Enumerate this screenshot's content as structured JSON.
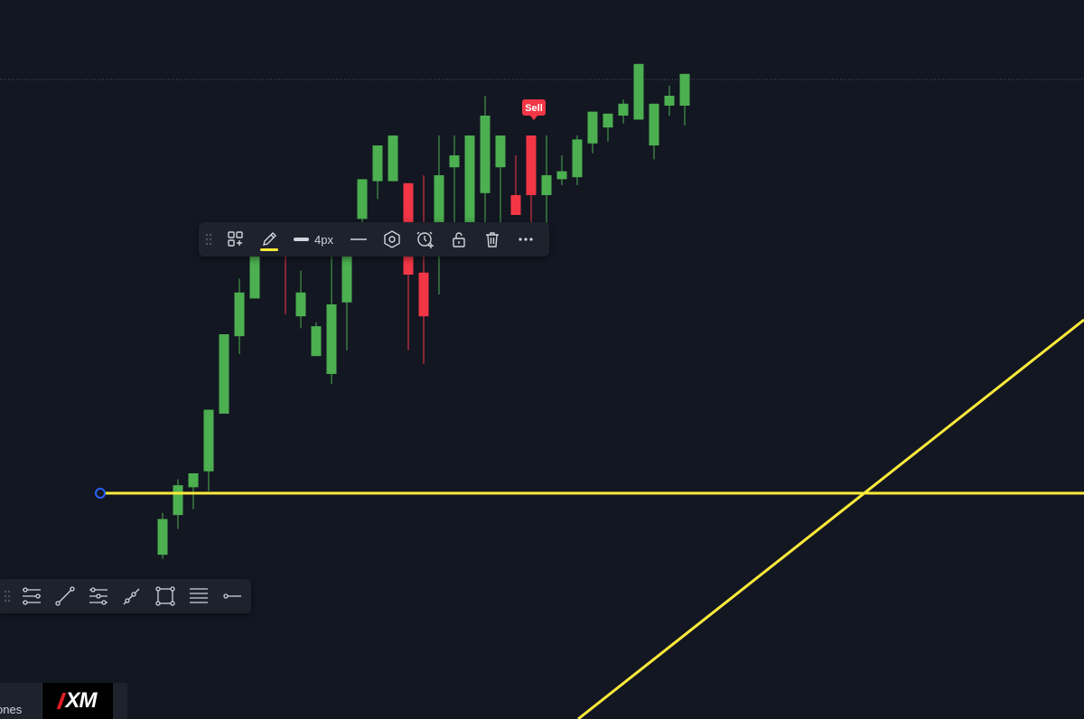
{
  "colors": {
    "background": "#131722",
    "bull": "#4caf50",
    "bear": "#f23645",
    "drawing": "#ffeb3b",
    "anchor": "#2962ff",
    "toolbar_bg": "#1e222d",
    "icon": "#d1d4dc"
  },
  "chart_data": {
    "type": "candlestick",
    "horizontal_line_price": 0,
    "candles": [
      {
        "o": -31,
        "h": -10,
        "l": -33,
        "c": -13
      },
      {
        "o": -11,
        "h": 7,
        "l": -18,
        "c": 4
      },
      {
        "o": 3,
        "h": 8,
        "l": -8,
        "c": 10
      },
      {
        "o": 11,
        "h": 41,
        "l": 1,
        "c": 42
      },
      {
        "o": 40,
        "h": 77,
        "l": 40,
        "c": 80
      },
      {
        "o": 79,
        "h": 108,
        "l": 70,
        "c": 101
      },
      {
        "o": 98,
        "h": 124,
        "l": 99,
        "c": 130
      },
      {
        "o": 127,
        "h": 131,
        "l": 120,
        "c": 125
      },
      {
        "o": 124,
        "h": 126,
        "l": 90,
        "c": 120
      },
      {
        "o": 89,
        "h": 112,
        "l": 83,
        "c": 101
      },
      {
        "o": 69,
        "h": 86,
        "l": 69,
        "c": 84
      },
      {
        "o": 60,
        "h": 126,
        "l": 55,
        "c": 95
      },
      {
        "o": 96,
        "h": 117,
        "l": 72,
        "c": 127
      },
      {
        "o": 138,
        "h": 140,
        "l": 120,
        "c": 158
      },
      {
        "o": 157,
        "h": 160,
        "l": 148,
        "c": 175
      },
      {
        "o": 157,
        "h": 170,
        "l": 160,
        "c": 180
      },
      {
        "o": 156,
        "h": 140,
        "l": 72,
        "c": 110
      },
      {
        "o": 111,
        "h": 160,
        "l": 65,
        "c": 89
      },
      {
        "o": 127,
        "h": 180,
        "l": 100,
        "c": 160
      },
      {
        "o": 164,
        "h": 180,
        "l": 135,
        "c": 170
      },
      {
        "o": 129,
        "h": 180,
        "l": 129,
        "c": 180
      },
      {
        "o": 151,
        "h": 200,
        "l": 135,
        "c": 190
      },
      {
        "o": 164,
        "h": 180,
        "l": 130,
        "c": 180
      },
      {
        "o": 150,
        "h": 170,
        "l": 160,
        "c": 140
      },
      {
        "o": 180,
        "h": 180,
        "l": 120,
        "c": 150
      },
      {
        "o": 150,
        "h": 180,
        "l": 130,
        "c": 160
      },
      {
        "o": 158,
        "h": 170,
        "l": 155,
        "c": 162
      },
      {
        "o": 159,
        "h": 180,
        "l": 155,
        "c": 178
      },
      {
        "o": 176,
        "h": 180,
        "l": 171,
        "c": 192
      },
      {
        "o": 184,
        "h": 187,
        "l": 177,
        "c": 191
      },
      {
        "o": 190,
        "h": 198,
        "l": 186,
        "c": 196
      },
      {
        "o": 188,
        "h": 207,
        "l": 189,
        "c": 216
      },
      {
        "o": 175,
        "h": 193,
        "l": 168,
        "c": 196
      },
      {
        "o": 195,
        "h": 205,
        "l": 190,
        "c": 200
      },
      {
        "o": 195,
        "h": 211,
        "l": 185,
        "c": 211
      }
    ]
  },
  "sell_label": "Sell",
  "toolbar": {
    "grip_icon": "drag-handle-icon",
    "templates_icon": "templates-add-icon",
    "color_icon": "pencil-color-icon",
    "width_label": "4px",
    "style_icon": "line-style-icon",
    "settings_icon": "settings-hexagon-icon",
    "alert_icon": "add-alert-icon",
    "lock_icon": "unlock-icon",
    "delete_icon": "trash-icon",
    "more_icon": "more-dots-icon"
  },
  "drawing_tools": [
    "parallel-channel-icon",
    "trend-line-icon",
    "regression-trend-icon",
    "ray-icon",
    "rectangle-icon",
    "horizontal-lines-icon",
    "horizontal-ray-icon"
  ],
  "bottom": {
    "tab_label": "ones",
    "broker_logo": "XM"
  }
}
